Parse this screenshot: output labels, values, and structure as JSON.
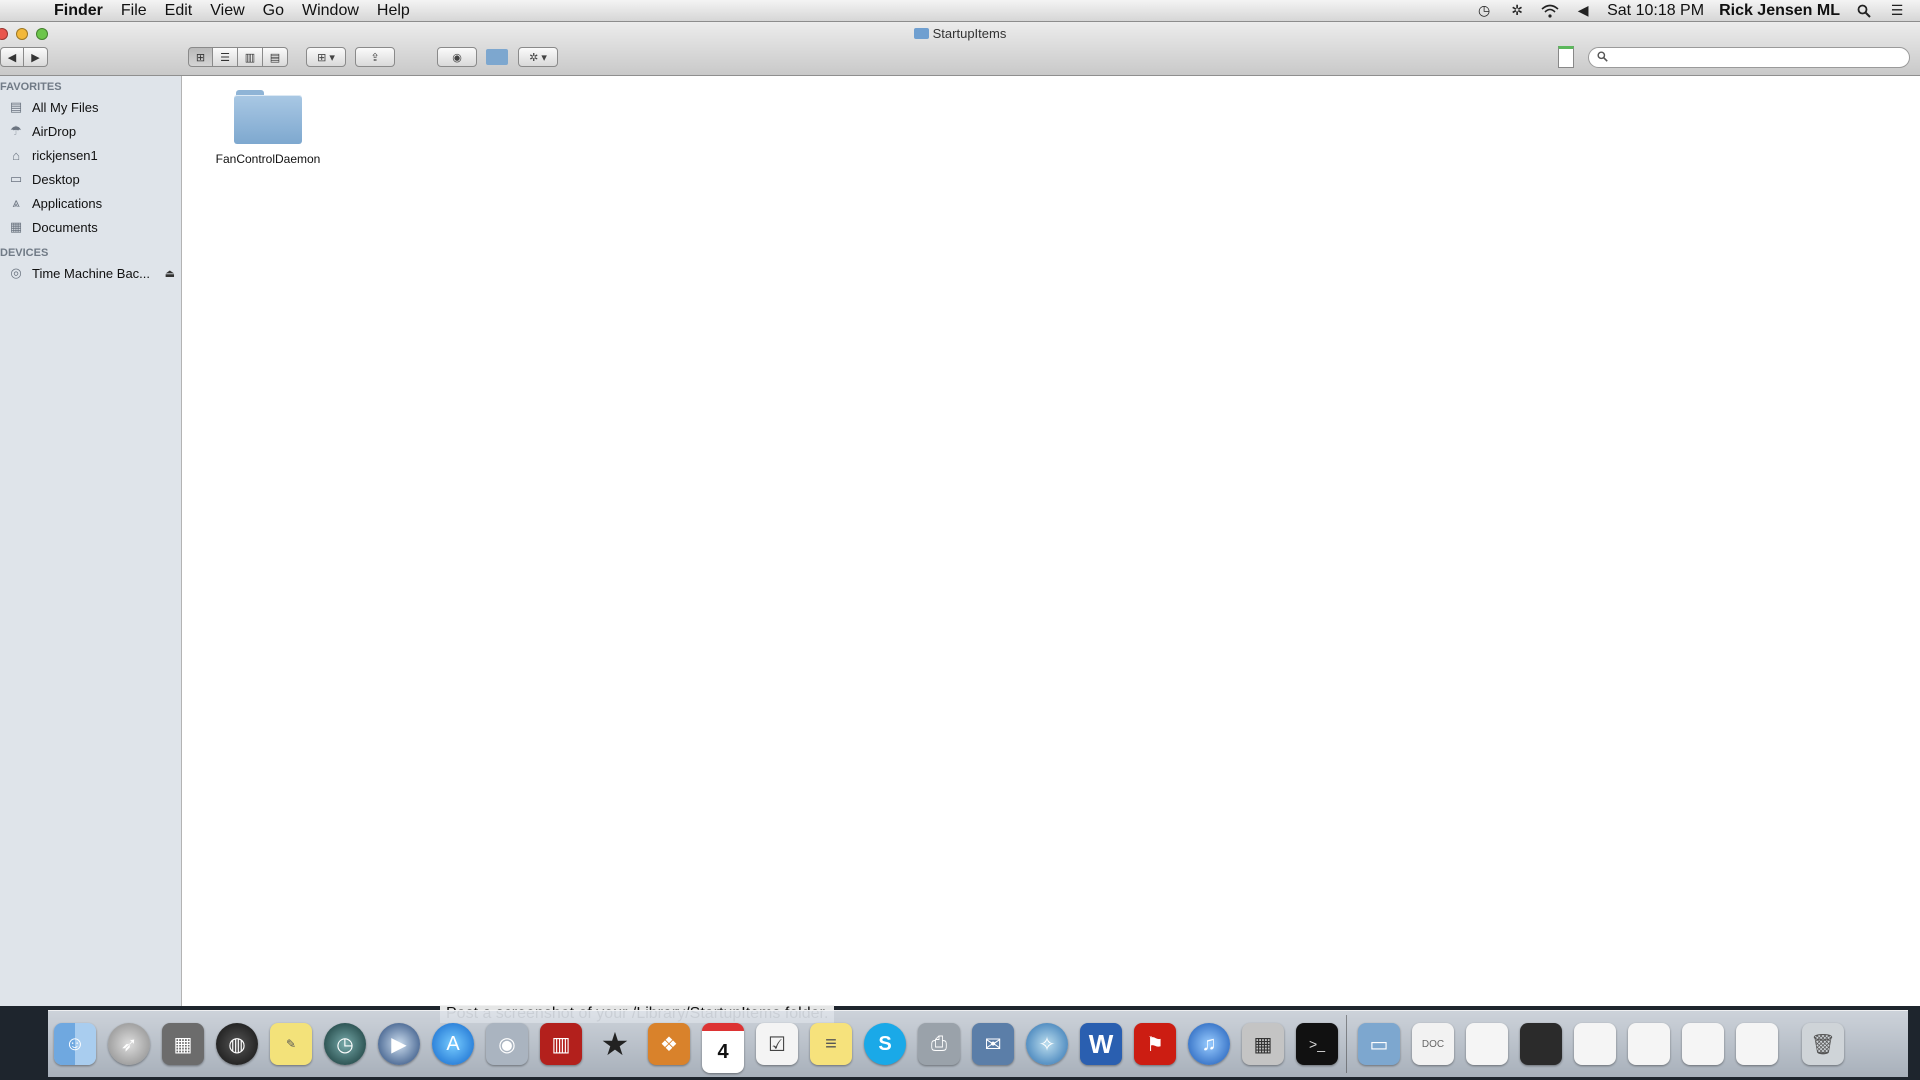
{
  "menubar": {
    "app": "Finder",
    "items": [
      "File",
      "Edit",
      "View",
      "Go",
      "Window",
      "Help"
    ],
    "clock": "Sat 10:18 PM",
    "user": "Rick Jensen ML"
  },
  "window": {
    "title": "StartupItems",
    "search_placeholder": ""
  },
  "sidebar": {
    "favorites_header": "FAVORITES",
    "favorites": [
      {
        "label": "All My Files",
        "icon": "all-files-icon"
      },
      {
        "label": "AirDrop",
        "icon": "airdrop-icon"
      },
      {
        "label": "rickjensen1",
        "icon": "home-icon"
      },
      {
        "label": "Desktop",
        "icon": "desktop-icon"
      },
      {
        "label": "Applications",
        "icon": "applications-icon"
      },
      {
        "label": "Documents",
        "icon": "documents-icon"
      }
    ],
    "devices_header": "DEVICES",
    "devices": [
      {
        "label": "Time Machine Bac...",
        "icon": "drive-icon"
      }
    ]
  },
  "content": {
    "items": [
      {
        "label": "FanControlDaemon",
        "icon": "folder-icon"
      }
    ]
  },
  "overlay": {
    "text": "Post a screenshot of your /Library/StartupItems folder."
  },
  "dock": {
    "icons": [
      "finder-icon",
      "launchpad-icon",
      "system-preferences-icon",
      "dashboard-icon",
      "stickies-icon",
      "time-machine-icon",
      "quicktime-icon",
      "app-store-icon",
      "facetime-icon",
      "photo-booth-icon",
      "imovie-icon",
      "iphoto-icon",
      "calendar-icon",
      "reminders-icon",
      "notes-icon",
      "skype-icon",
      "printer-icon",
      "mail-icon",
      "safari-icon",
      "word-icon",
      "acrobat-icon",
      "itunes-icon",
      "calculator-icon",
      "terminal-icon",
      "applications-stack-icon",
      "document-icon",
      "document-stack-icon",
      "trash-icon"
    ],
    "calendar_day": "4"
  }
}
